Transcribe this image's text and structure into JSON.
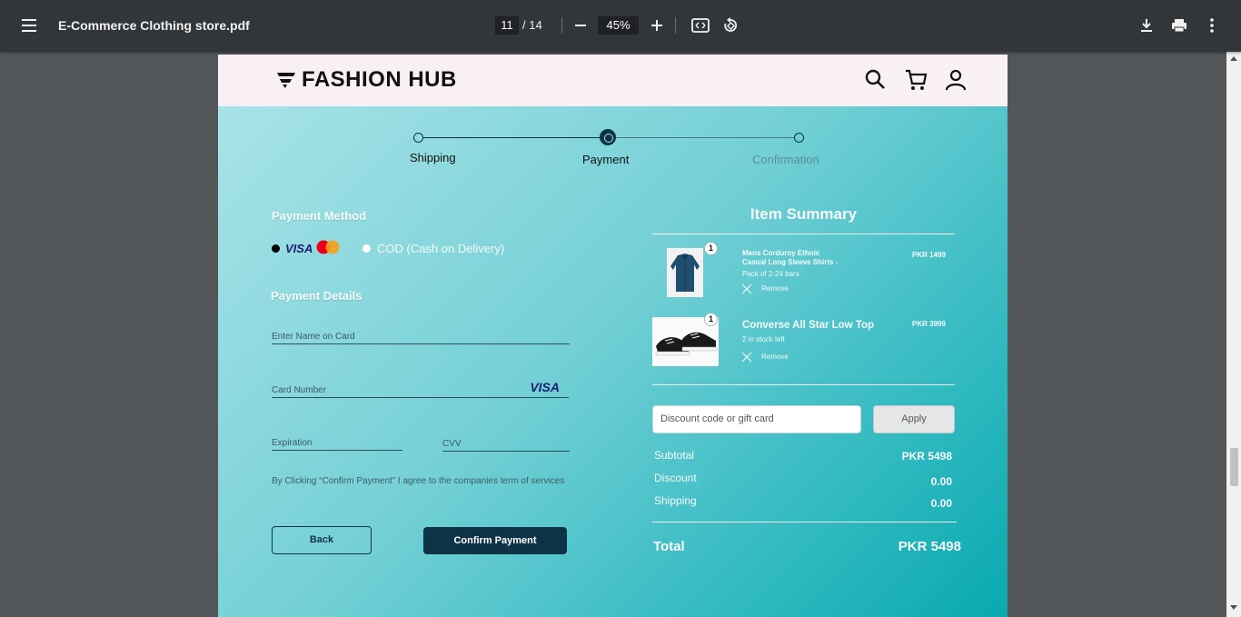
{
  "viewer": {
    "file_name": "E-Commerce Clothing store.pdf",
    "current_page": "11",
    "total_pages": "/ 14",
    "zoom": "45%"
  },
  "brand": {
    "name": "FASHION HUB"
  },
  "steps": [
    {
      "label": "Shipping",
      "state": "done"
    },
    {
      "label": "Payment",
      "state": "active"
    },
    {
      "label": "Confirmation",
      "state": "pending"
    }
  ],
  "payment": {
    "method_title": "Payment Method",
    "visa_label": "VISA",
    "cod_label": "COD (Cash on Delivery)",
    "details_title": "Payment Details",
    "name_placeholder": "Enter Name on Card",
    "card_placeholder": "Card Number",
    "card_brand": "VISA",
    "expiration_placeholder": "Expiration",
    "cvv_placeholder": "CVV",
    "terms": "By Clicking “Confirm Payment” I agree to the companies term of services",
    "back_label": "Back",
    "confirm_label": "Confirm Payment"
  },
  "summary": {
    "title": "Item Summary",
    "items": [
      {
        "qty": "1",
        "name_line1": "Mens Corduroy Ethnic",
        "name_line2": "Casual Long Sleeve Shirts -",
        "sub": "Pack of 2-24 bars",
        "price": "PKR 1499",
        "remove": "Remove"
      },
      {
        "qty": "1",
        "name": "Converse All Star Low Top",
        "sub": "2 in stock left",
        "price": "PKR 3999",
        "remove": "Remove"
      }
    ],
    "discount_placeholder": "Discount code or gift card",
    "apply_label": "Apply",
    "subtotal_label": "Subtotal",
    "subtotal_value": "PKR 5498",
    "discount_label": "Discount",
    "discount_value": "0.00",
    "shipping_label": "Shipping",
    "shipping_value": "0.00",
    "total_label": "Total",
    "total_value": "PKR 5498"
  },
  "colors": {
    "toolbar": "#323639",
    "viewer_bg": "#525659",
    "header_bg": "#f8f0f5",
    "accent_dark": "#0f3346",
    "gradient_start": "#a8e3e8",
    "gradient_end": "#0aa9b0"
  }
}
